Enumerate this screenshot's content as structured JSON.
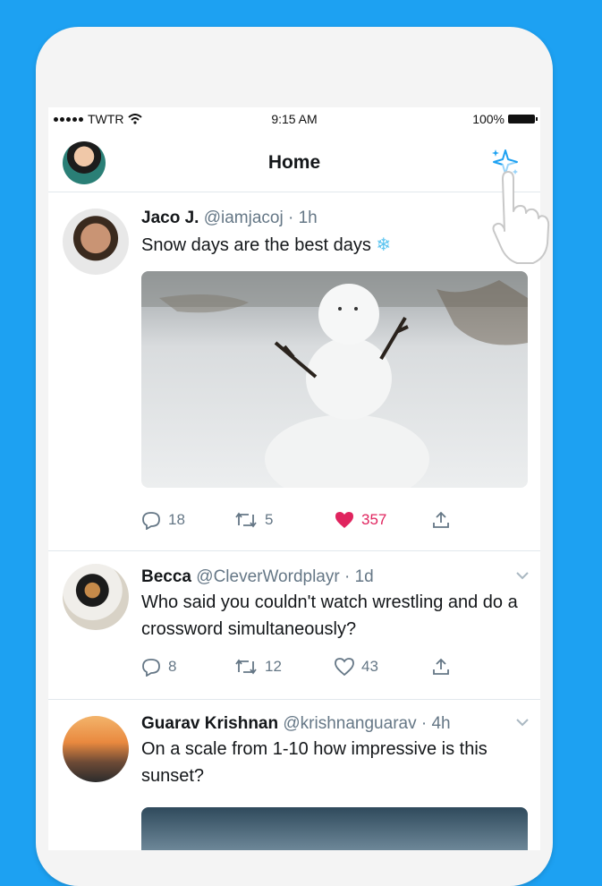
{
  "status_bar": {
    "carrier": "TWTR",
    "time": "9:15 AM",
    "battery": "100%"
  },
  "header": {
    "title": "Home"
  },
  "tweets": [
    {
      "name": "Jaco J.",
      "handle": "@iamjacoj",
      "time": "1h",
      "text": "Snow days are the best days",
      "emoji": "❄",
      "replies": "18",
      "retweets": "5",
      "likes": "357",
      "liked": true
    },
    {
      "name": "Becca",
      "handle": "@CleverWordplayr",
      "time": "1d",
      "text": "Who said you couldn't watch wrestling and do a crossword simultaneously?",
      "replies": "8",
      "retweets": "12",
      "likes": "43",
      "liked": false
    },
    {
      "name": "Guarav Krishnan",
      "handle": "@krishnanguarav",
      "time": "4h",
      "text": "On a scale from 1-10 how impressive is this sunset?"
    }
  ],
  "separator": " · ",
  "colors": {
    "brand": "#1DA1F2",
    "like": "#E0245E",
    "secondary": "#657786",
    "text": "#14171A"
  }
}
